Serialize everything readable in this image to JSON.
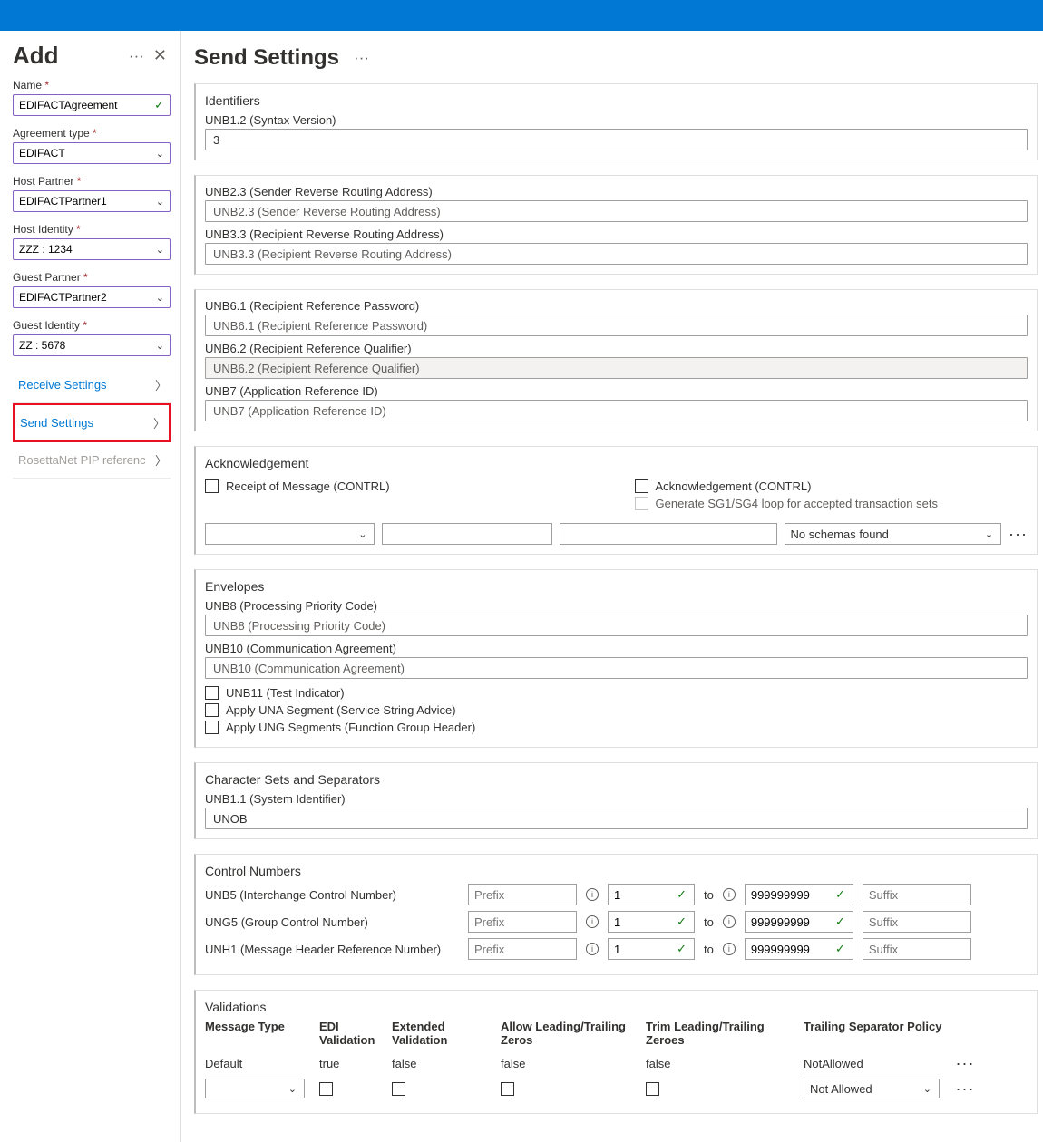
{
  "sidebar": {
    "title": "Add",
    "fields": {
      "name": {
        "label": "Name",
        "value": "EDIFACTAgreement"
      },
      "agreement_type": {
        "label": "Agreement type",
        "value": "EDIFACT"
      },
      "host_partner": {
        "label": "Host Partner",
        "value": "EDIFACTPartner1"
      },
      "host_identity": {
        "label": "Host Identity",
        "value": "ZZZ : 1234"
      },
      "guest_partner": {
        "label": "Guest Partner",
        "value": "EDIFACTPartner2"
      },
      "guest_identity": {
        "label": "Guest Identity",
        "value": "ZZ : 5678"
      }
    },
    "nav": {
      "receive": "Receive Settings",
      "send": "Send Settings",
      "rosetta": "RosettaNet PIP referenc"
    }
  },
  "main": {
    "title": "Send Settings",
    "identifiers": {
      "title": "Identifiers",
      "unb12_label": "UNB1.2 (Syntax Version)",
      "unb12_value": "3",
      "unb23_label": "UNB2.3 (Sender Reverse Routing Address)",
      "unb23_ph": "UNB2.3 (Sender Reverse Routing Address)",
      "unb33_label": "UNB3.3 (Recipient Reverse Routing Address)",
      "unb33_ph": "UNB3.3 (Recipient Reverse Routing Address)",
      "unb61_label": "UNB6.1 (Recipient Reference Password)",
      "unb61_ph": "UNB6.1 (Recipient Reference Password)",
      "unb62_label": "UNB6.2 (Recipient Reference Qualifier)",
      "unb62_ph": "UNB6.2 (Recipient Reference Qualifier)",
      "unb7_label": "UNB7 (Application Reference ID)",
      "unb7_ph": "UNB7 (Application Reference ID)"
    },
    "ack": {
      "title": "Acknowledgement",
      "receipt": "Receipt of Message (CONTRL)",
      "ack": "Acknowledgement (CONTRL)",
      "sg": "Generate SG1/SG4 loop for accepted transaction sets",
      "no_schemas": "No schemas found"
    },
    "envelopes": {
      "title": "Envelopes",
      "unb8_label": "UNB8 (Processing Priority Code)",
      "unb8_ph": "UNB8 (Processing Priority Code)",
      "unb10_label": "UNB10 (Communication Agreement)",
      "unb10_ph": "UNB10 (Communication Agreement)",
      "unb11": "UNB11 (Test Indicator)",
      "una": "Apply UNA Segment (Service String Advice)",
      "ung": "Apply UNG Segments (Function Group Header)"
    },
    "charset": {
      "title": "Character Sets and Separators",
      "unb11_label": "UNB1.1 (System Identifier)",
      "unb11_value": "UNOB"
    },
    "control": {
      "title": "Control Numbers",
      "rows": [
        {
          "label": "UNB5 (Interchange Control Number)"
        },
        {
          "label": "UNG5 (Group Control Number)"
        },
        {
          "label": "UNH1 (Message Header Reference Number)"
        }
      ],
      "prefix": "Prefix",
      "from": "1",
      "to": "to",
      "toval": "999999999",
      "suffix": "Suffix"
    },
    "validations": {
      "title": "Validations",
      "headers": [
        "Message Type",
        "EDI Validation",
        "Extended Validation",
        "Allow Leading/Trailing Zeros",
        "Trim Leading/Trailing Zeroes",
        "Trailing Separator Policy"
      ],
      "default_row": [
        "Default",
        "true",
        "false",
        "false",
        "false",
        "NotAllowed"
      ],
      "not_allowed": "Not Allowed"
    }
  }
}
